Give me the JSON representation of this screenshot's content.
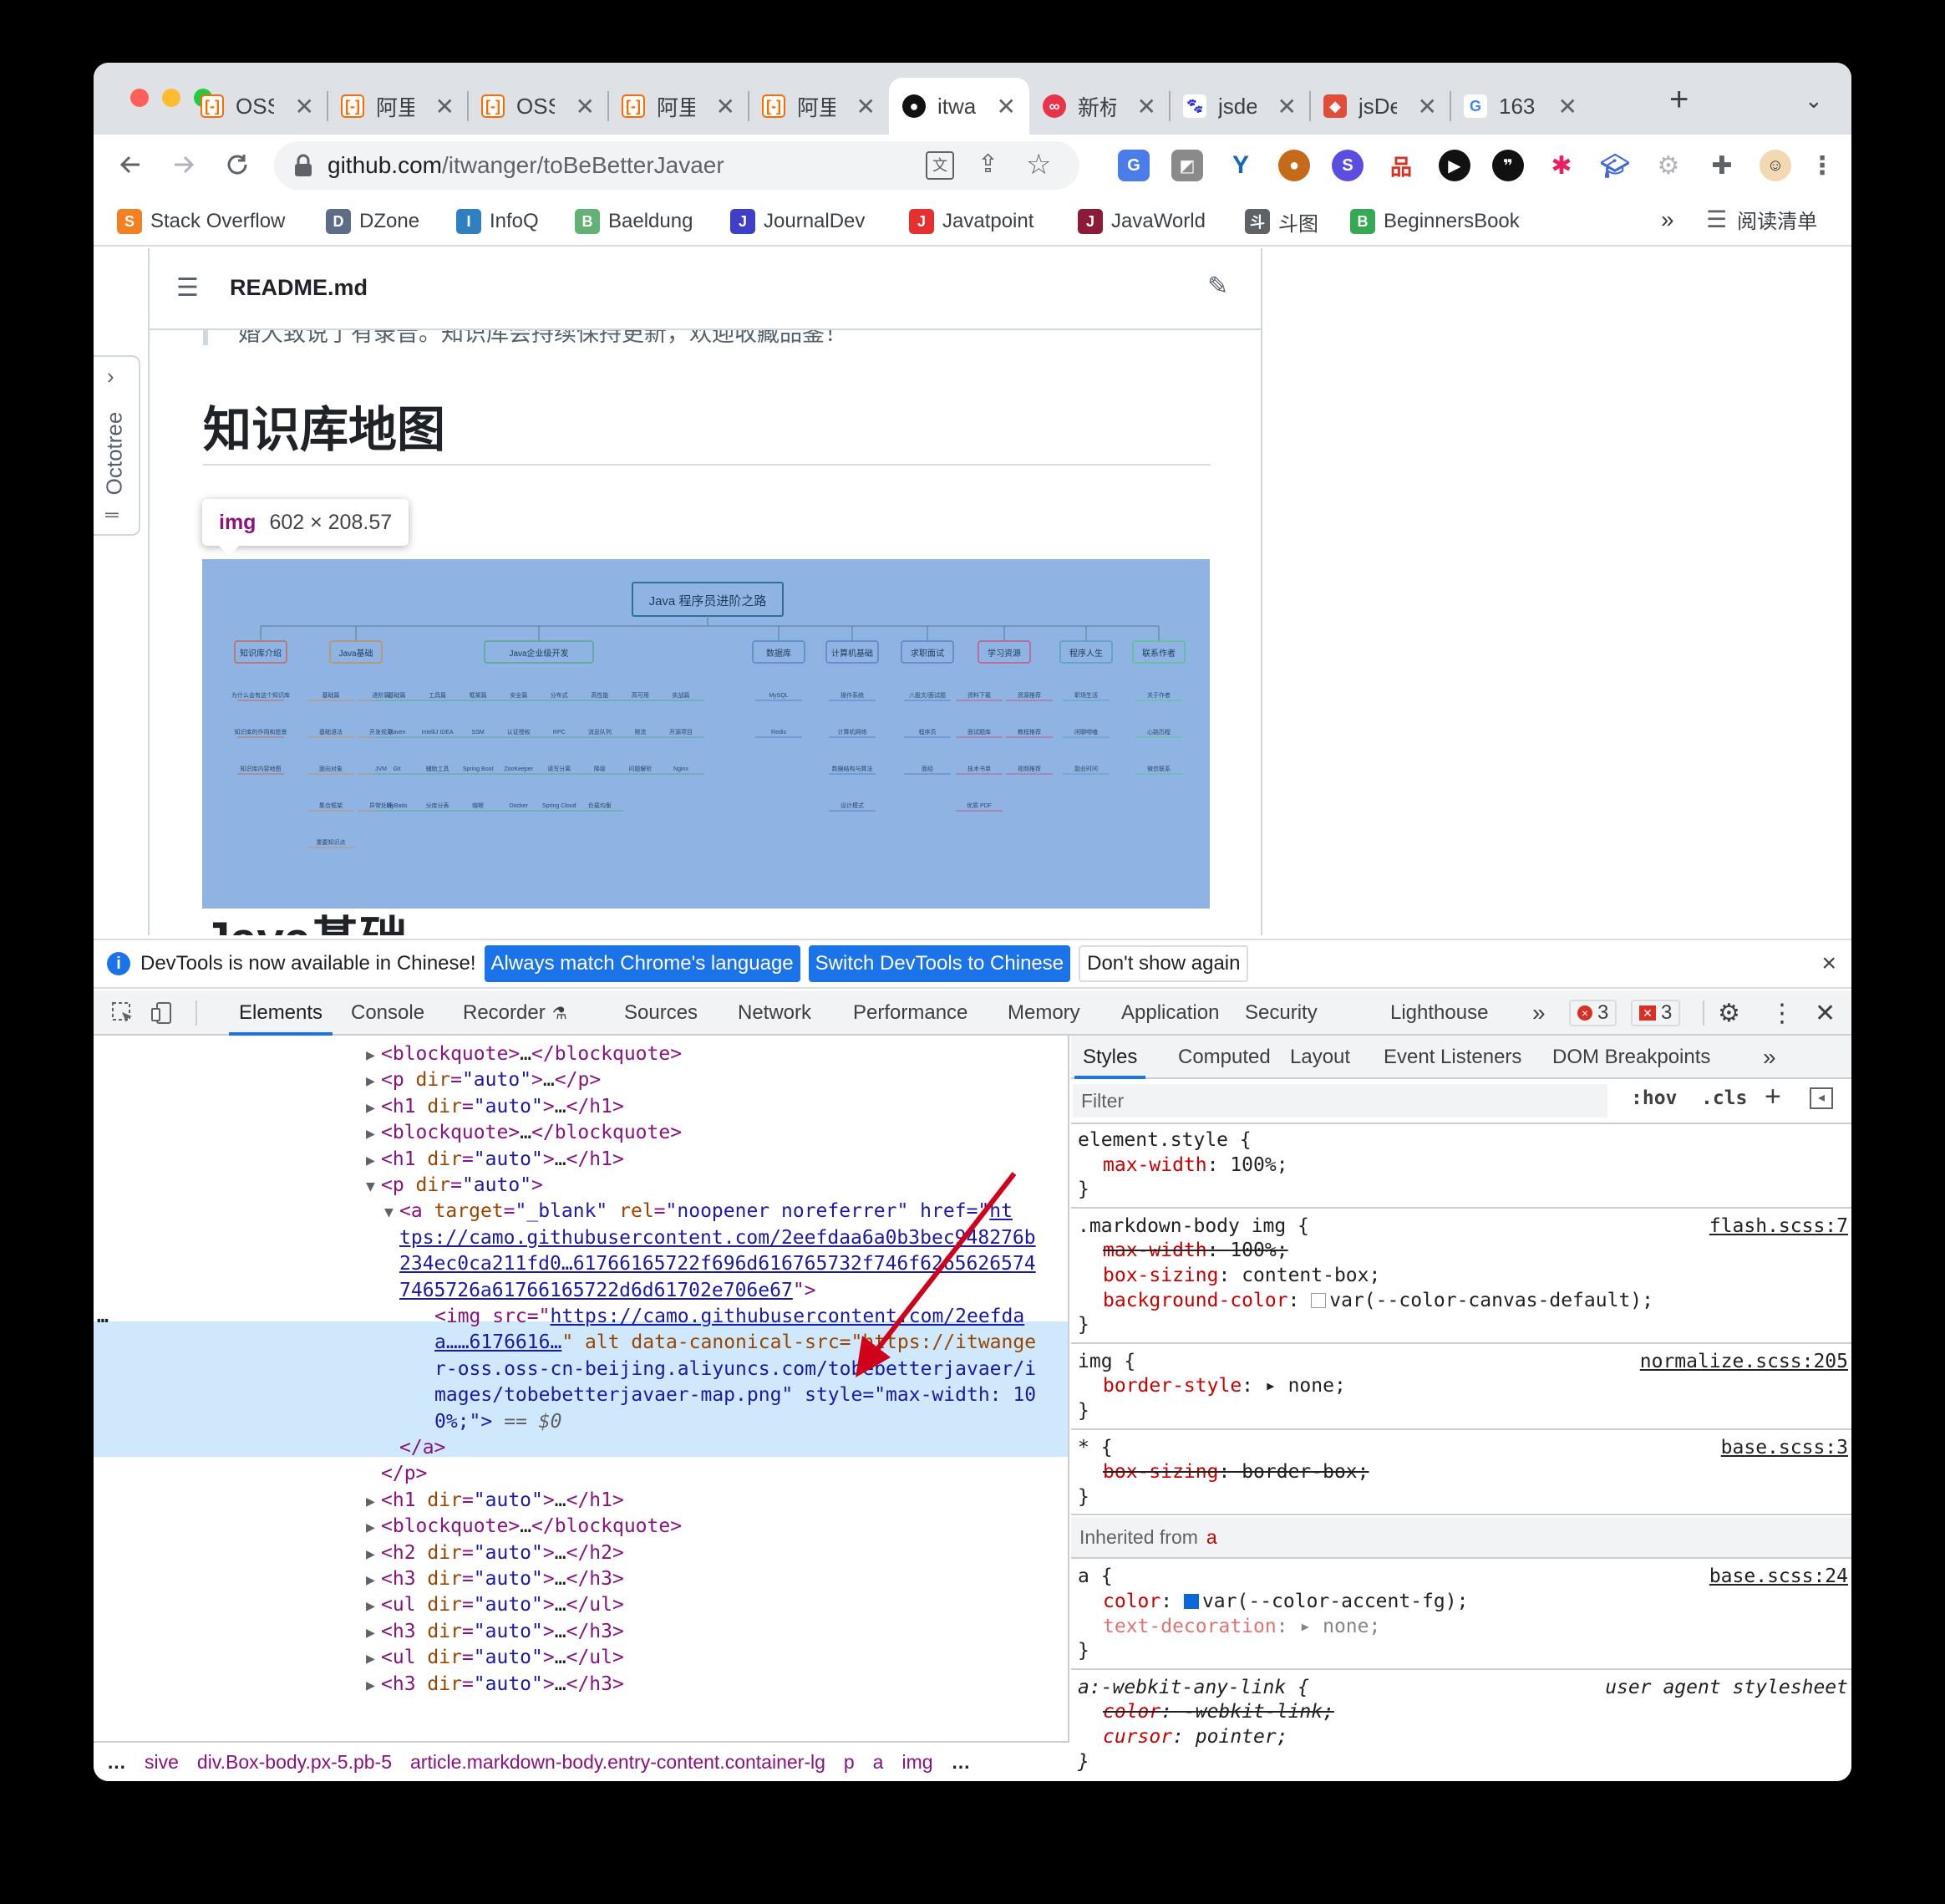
{
  "tabs": [
    {
      "label": "OSS",
      "icon": "aliyun-icon"
    },
    {
      "label": "阿里",
      "icon": "aliyun-icon"
    },
    {
      "label": "OSS",
      "icon": "aliyun-icon"
    },
    {
      "label": "阿里",
      "icon": "aliyun-icon"
    },
    {
      "label": "阿里",
      "icon": "aliyun-icon"
    },
    {
      "label": "itwa",
      "icon": "github-icon",
      "active": true
    },
    {
      "label": "新标",
      "icon": "infinity-icon"
    },
    {
      "label": "jsde",
      "icon": "baidu-icon"
    },
    {
      "label": "jsDe",
      "icon": "shield-icon"
    },
    {
      "label": "163",
      "icon": "google-icon"
    }
  ],
  "address": {
    "host": "github.com",
    "path": "/itwanger/toBeBetterJavaer"
  },
  "bookmarks": [
    {
      "label": "Stack Overflow",
      "color": "#f48024"
    },
    {
      "label": "DZone",
      "color": "#5d6d88"
    },
    {
      "label": "InfoQ",
      "color": "#2f7fc1"
    },
    {
      "label": "Baeldung",
      "color": "#63b175"
    },
    {
      "label": "JournalDev",
      "color": "#3f3fc8"
    },
    {
      "label": "Javatpoint",
      "color": "#e53030"
    },
    {
      "label": "JavaWorld",
      "color": "#8a1c3a"
    },
    {
      "label": "斗图",
      "color": "#5f6368"
    },
    {
      "label": "BeginnersBook",
      "color": "#34a853"
    }
  ],
  "bookmarks_more": "»",
  "reading_list": "阅读清单",
  "readme": {
    "filename": "README.md",
    "blockquote_fragment": "婚大致说了有录音。知识库会持续保持更新，欢迎收藏品鉴！",
    "heading1": "知识库地图",
    "heading2": "Java基础",
    "octotree_label": "Octotree"
  },
  "tooltip": {
    "tag": "img",
    "size": "602 × 208.57"
  },
  "mindmap": {
    "root": "Java 程序员进阶之路",
    "branches": [
      {
        "name": "知识库介绍",
        "items": [
          "为什么会有这个知识库",
          "知识库的作用和愿景",
          "知识库内容地图"
        ]
      },
      {
        "name": "Java基础",
        "items": [
          "基础篇",
          "进阶篇",
          "基础语法",
          "开发规范",
          "面向对象",
          "JVM",
          "集合框架",
          "异常处理",
          "重要知识点"
        ]
      },
      {
        "name": "Java企业级开发",
        "items": [
          "基础篇",
          "工具篇",
          "框架篇",
          "安全篇",
          "分布式",
          "高性能",
          "高可用",
          "实战篇",
          "Maven",
          "IntelliJ IDEA",
          "SSM",
          "认证授权",
          "RPC",
          "消息队列",
          "限流",
          "开源项目",
          "Git",
          "辅助工具",
          "Spring Boot",
          "ZooKeeper",
          "读写分离",
          "降级",
          "问题解析",
          "Nginx",
          "MyBatis",
          "分库分表",
          "熔断",
          "Docker",
          "Spring Cloud",
          "负载均衡"
        ]
      },
      {
        "name": "数据库",
        "items": [
          "MySQL",
          "Redis"
        ]
      },
      {
        "name": "计算机基础",
        "items": [
          "操作系统",
          "计算机网络",
          "数据结构与算法",
          "设计模式"
        ]
      },
      {
        "name": "求职面试",
        "items": [
          "八股文/面试题",
          "程序员",
          "面经"
        ]
      },
      {
        "name": "学习资源",
        "items": [
          "资料下载",
          "资源推荐",
          "面试题库",
          "教程推荐",
          "技术书单",
          "视频推荐",
          "优质 PDF"
        ]
      },
      {
        "name": "程序人生",
        "items": [
          "职场生活",
          "闲聊唠嗑",
          "副业时间"
        ]
      },
      {
        "name": "联系作者",
        "items": [
          "关于作者",
          "心路历程",
          "微信联系"
        ]
      }
    ]
  },
  "infobar": {
    "message": "DevTools is now available in Chinese!",
    "btn1": "Always match Chrome's language",
    "btn2": "Switch DevTools to Chinese",
    "btn3": "Don't show again",
    "close": "×"
  },
  "devtools_tabs": [
    "Elements",
    "Console",
    "Recorder",
    "Sources",
    "Network",
    "Performance",
    "Memory",
    "Application",
    "Security",
    "Lighthouse"
  ],
  "devtools_more": "»",
  "errors": {
    "errors_count": "3",
    "issues_count": "3"
  },
  "elements": {
    "lines": [
      {
        "indent": 0,
        "tri": "▶",
        "html": "<blockquote>…</blockquote>"
      },
      {
        "indent": 0,
        "tri": "▶",
        "html": "<p dir=\"auto\">…</p>"
      },
      {
        "indent": 0,
        "tri": "▶",
        "html": "<h1 dir=\"auto\">…</h1>"
      },
      {
        "indent": 0,
        "tri": "▶",
        "html": "<blockquote>…</blockquote>"
      },
      {
        "indent": 0,
        "tri": "▶",
        "html": "<h1 dir=\"auto\">…</h1>"
      },
      {
        "indent": 0,
        "tri": "▼",
        "html": "<p dir=\"auto\">"
      }
    ],
    "anchor_line1_prefix": "<a target=\"_blank\" rel=\"noopener noreferrer\" href=\"",
    "anchor_line1_link": "ht",
    "anchor_link_lines": [
      "tps://camo.githubusercontent.com/2eefdaa6a0b3bec948276b",
      "234ec0ca211fd0…61766165722f696d616765732f746f6265626574",
      "7465726a61766165722d6d61702e706e67"
    ],
    "anchor_close": "\">",
    "img_line1_prefix": "<img src=\"",
    "img_line1_link": "https://camo.githubusercontent.com/2eefda",
    "img_line2_link": "a……6176616…",
    "img_line2_rest": "\" alt data-canonical-src=\"https://itwange",
    "img_line3": "r-oss.oss-cn-beijing.aliyuncs.com/tobebetterjavaer/i",
    "img_line4": "mages/tobebetterjavaer-map.png\" style=\"max-width: 10",
    "img_line5": "0%;\">",
    "img_eq": "== $0",
    "dots": "…",
    "a_close": "</a>",
    "p_close": "</p>",
    "after_lines": [
      "<h1 dir=\"auto\">…</h1>",
      "<blockquote>…</blockquote>",
      "<h2 dir=\"auto\">…</h2>",
      "<h3 dir=\"auto\">…</h3>",
      "<ul dir=\"auto\">…</ul>",
      "<h3 dir=\"auto\">…</h3>",
      "<ul dir=\"auto\">…</ul>",
      "<h3 dir=\"auto\">…</h3>"
    ]
  },
  "breadcrumbs": [
    "…",
    "sive",
    "div.Box-body.px-5.pb-5",
    "article.markdown-body.entry-content.container-lg",
    "p",
    "a",
    "img",
    "…"
  ],
  "styles": {
    "tabs": [
      "Styles",
      "Computed",
      "Layout",
      "Event Listeners",
      "DOM Breakpoints"
    ],
    "tabs_more": "»",
    "filter_placeholder": "Filter",
    "hov": ":hov",
    "cls": ".cls",
    "rules": [
      {
        "selector": "element.style {",
        "source": "",
        "props": [
          {
            "name": "max-width",
            "value": "100%;",
            "struck": false
          }
        ]
      },
      {
        "selector": ".markdown-body img {",
        "source": "flash.scss:7",
        "props": [
          {
            "name": "max-width",
            "value": "100%;",
            "struck": true
          },
          {
            "name": "box-sizing",
            "value": "content-box;",
            "struck": false
          },
          {
            "name": "background-color",
            "value": "var(--color-canvas-default);",
            "struck": false
          }
        ]
      },
      {
        "selector": "img {",
        "source": "normalize.scss:205",
        "props": [
          {
            "name": "border-style",
            "value": "▸ none;",
            "struck": false
          }
        ]
      },
      {
        "selector": "* {",
        "source": "base.scss:3",
        "props": [
          {
            "name": "box-sizing",
            "value": "border-box;",
            "struck": true
          }
        ]
      }
    ],
    "inherited_label": "Inherited from",
    "inherited_tag": "a",
    "rule_a": {
      "selector": "a {",
      "source": "base.scss:24",
      "color_name": "color",
      "color_value": "var(--color-accent-fg);",
      "td_name": "text-decoration",
      "td_value": "▸ none;"
    },
    "rule_ua": {
      "selector": "a:-webkit-any-link {",
      "source": "user agent stylesheet",
      "p1_name": "color",
      "p1_value": "-webkit-link;",
      "p2_name": "cursor",
      "p2_value": "pointer;"
    },
    "close_brace": "}"
  },
  "colors": {
    "accent": "#1a73e8",
    "tag": "#881280",
    "attr": "#994500",
    "value": "#1a1aa6",
    "selection": "#cfe8fc",
    "annotation": "#d0021b"
  }
}
